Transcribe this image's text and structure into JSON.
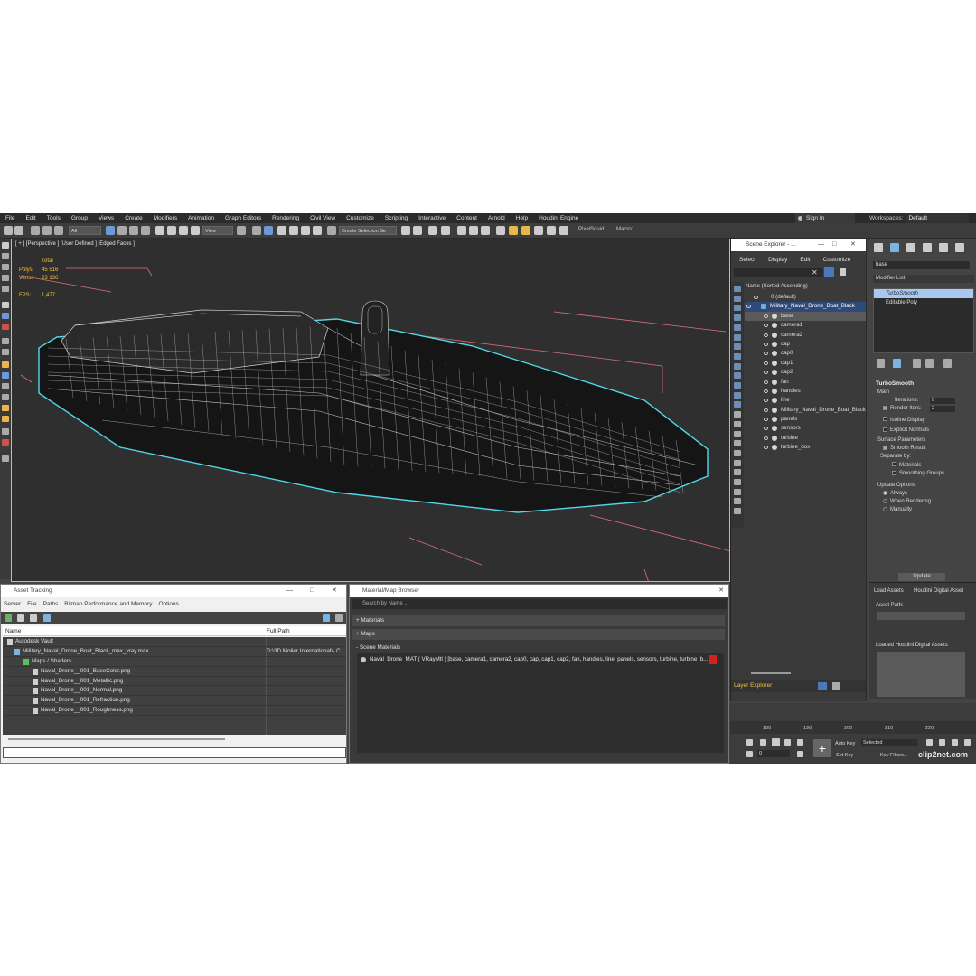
{
  "menu": [
    "File",
    "Edit",
    "Tools",
    "Group",
    "Views",
    "Create",
    "Modifiers",
    "Animation",
    "Graph Editors",
    "Rendering",
    "Civil View",
    "Customize",
    "Scripting",
    "Interactive",
    "Content",
    "Arnold",
    "Help",
    "Houdini Engine"
  ],
  "signin": "Sign In",
  "workspace": {
    "label": "Workspaces:",
    "value": "Default"
  },
  "toolbar": {
    "filter_value": "All",
    "view_value": "View",
    "selection_set_placeholder": "Create Selection Se",
    "pixelsquid": "PixelSquid",
    "macro": "Macro1"
  },
  "viewport": {
    "label": "[ + ] [Perspective ] [User Defined ] [Edged Faces ]",
    "stats": {
      "total_label": "Total",
      "polys_label": "Polys:",
      "polys_value": "45 516",
      "verts_label": "Verts:",
      "verts_value": "23 136",
      "fps_label": "FPS:",
      "fps_value": "1,477"
    }
  },
  "scene_explorer": {
    "title": "Scene Explorer - ...",
    "menu": [
      "Select",
      "Display",
      "Edit",
      "Customize"
    ],
    "column_header": "Name (Sorted Ascending)",
    "items": [
      {
        "label": "0 (default)",
        "indent": 0
      },
      {
        "label": "Military_Naval_Drone_Boat_Black",
        "indent": 1
      },
      {
        "label": "base",
        "indent": 2
      },
      {
        "label": "camera1",
        "indent": 2
      },
      {
        "label": "camera2",
        "indent": 2
      },
      {
        "label": "cap",
        "indent": 2
      },
      {
        "label": "cap0",
        "indent": 2
      },
      {
        "label": "cap1",
        "indent": 2
      },
      {
        "label": "cap2",
        "indent": 2
      },
      {
        "label": "fan",
        "indent": 2
      },
      {
        "label": "handles",
        "indent": 2
      },
      {
        "label": "line",
        "indent": 2
      },
      {
        "label": "Military_Naval_Drone_Boat_Black",
        "indent": 2
      },
      {
        "label": "panels",
        "indent": 2
      },
      {
        "label": "sensors",
        "indent": 2
      },
      {
        "label": "turbine",
        "indent": 2
      },
      {
        "label": "turbine_box",
        "indent": 2
      }
    ],
    "layer_explorer": "Layer Explorer"
  },
  "command_panel": {
    "object_name": "base",
    "modifier_list": "Modifier List",
    "modifiers": [
      "TurboSmooth",
      "Editable Poly"
    ],
    "rollout": {
      "title": "TurboSmooth",
      "main": "Main",
      "iterations_label": "Iterations:",
      "iterations_value": "0",
      "render_iters_label": "Render Iters:",
      "render_iters_value": "2",
      "isoline": "Isoline Display",
      "explicit_normals": "Explicit Normals",
      "surface_params": "Surface Parameters",
      "smooth_result": "Smooth Result",
      "separate_by": "Separate by:",
      "materials": "Materials",
      "smoothing_groups": "Smoothing Groups",
      "update_options": "Update Options",
      "always": "Always",
      "when_rendering": "When Rendering",
      "manually": "Manually",
      "update_button": "Update"
    }
  },
  "houdini_panel": {
    "tab_load": "Load Assets",
    "tab_digital": "Houdini Digital Asset",
    "asset_path": "Asset Path:",
    "loaded_assets": "Loaded Houdini Digital Assets"
  },
  "asset_tracking": {
    "title": "Asset Tracking",
    "menu": [
      "Server",
      "File",
      "Paths",
      "Bitmap Performance and Memory",
      "Options"
    ],
    "col_name": "Name",
    "col_path": "Full Path",
    "rows": [
      {
        "name": "Autodesk Vault",
        "path": "",
        "indent": 0
      },
      {
        "name": "Military_Naval_Drone_Boat_Black_max_vray.max",
        "path": "D:\\3D Molier International\\- C",
        "indent": 1
      },
      {
        "name": "Maps / Shaders",
        "path": "",
        "indent": 2
      },
      {
        "name": "Naval_Drone__001_BaseColor.png",
        "path": "",
        "indent": 3
      },
      {
        "name": "Naval_Drone__001_Metallic.png",
        "path": "",
        "indent": 3
      },
      {
        "name": "Naval_Drone__001_Normal.png",
        "path": "",
        "indent": 3
      },
      {
        "name": "Naval_Drone__001_Refraction.png",
        "path": "",
        "indent": 3
      },
      {
        "name": "Naval_Drone__001_Roughness.png",
        "path": "",
        "indent": 3
      }
    ]
  },
  "material_browser": {
    "title": "Material/Map Browser",
    "search_placeholder": "Search by Name ...",
    "sections": [
      "+ Materials",
      "+ Maps",
      "- Scene Materials"
    ],
    "material": "Naval_Drone_MAT  ( VRayMtl )  [base, camera1, camera2, cap0, cap, cap1, cap2, fan, handles, line, panels, sensors, turbine, turbine_b..."
  },
  "timeline": {
    "ticks": [
      "180",
      "190",
      "200",
      "210",
      "220"
    ],
    "frame_value": "0",
    "auto_key": "Auto Key",
    "selected": "Selected",
    "set_key": "Set Key",
    "key_filters": "Key Filters..."
  },
  "watermark": "clip2net.com",
  "colors": {
    "selection_cyan": "#4fd8e8",
    "viewport_bg": "#2f2f2f",
    "bbox_pink": "#e0707a",
    "active_border": "#f2c218"
  }
}
